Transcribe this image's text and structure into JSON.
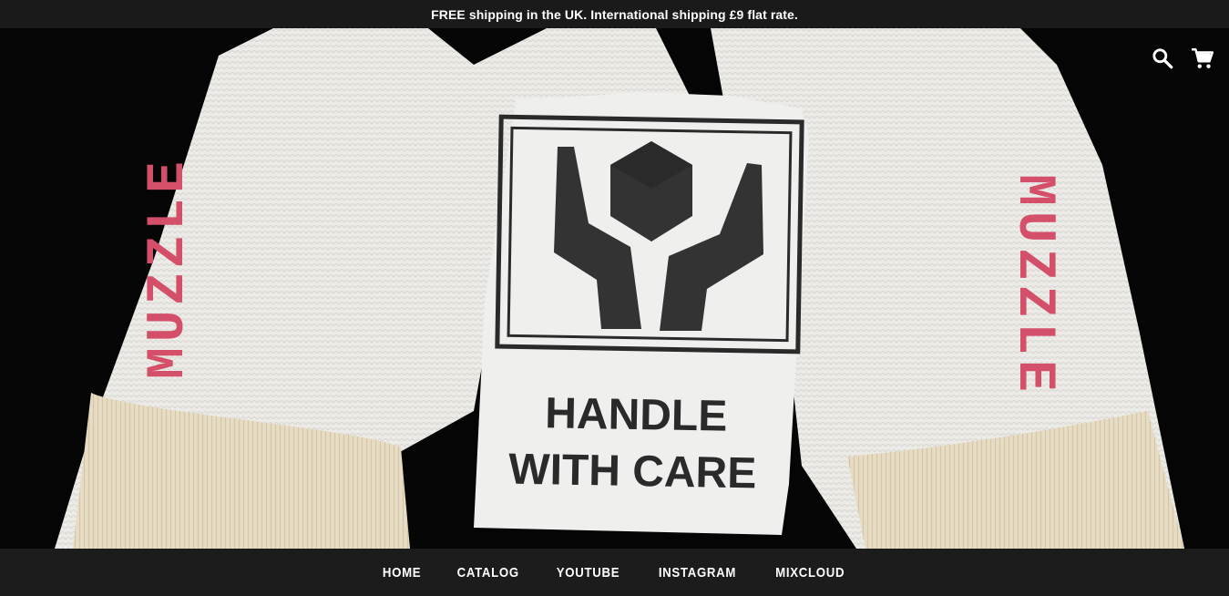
{
  "announcement": "FREE shipping in the UK. International shipping £9 flat rate.",
  "hero": {
    "label_line1": "HANDLE",
    "label_line2": "WITH CARE",
    "glove_left_text": "MUZZLE",
    "glove_right_text": "MUZZLE"
  },
  "header": {
    "icons": [
      "search-icon",
      "cart-icon"
    ]
  },
  "nav": {
    "items": [
      {
        "label": "HOME"
      },
      {
        "label": "CATALOG"
      },
      {
        "label": "YOUTUBE"
      },
      {
        "label": "INSTAGRAM"
      },
      {
        "label": "MIXCLOUD"
      }
    ]
  },
  "colors": {
    "bar_bg": "#1a1a1a",
    "hero_bg": "#050505",
    "glove": "#ececea",
    "cuff": "#e6dcc2",
    "stamp": "#d4506a"
  }
}
